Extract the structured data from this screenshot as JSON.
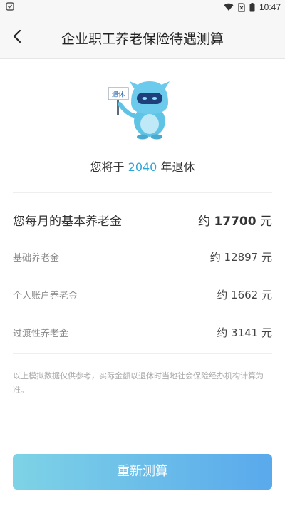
{
  "status_bar": {
    "time": "10:47"
  },
  "header": {
    "title": "企业职工养老保险待遇测算"
  },
  "mascot": {
    "sign_text": "退休"
  },
  "retire": {
    "prefix": "您将于",
    "year": "2040",
    "suffix": "年退休"
  },
  "pension": {
    "main": {
      "label": "您每月的基本养老金",
      "prefix": "约",
      "amount": "17700",
      "unit": "元"
    },
    "items": [
      {
        "label": "基础养老金",
        "value": "约 12897 元"
      },
      {
        "label": "个人账户养老金",
        "value": "约 1662 元"
      },
      {
        "label": "过渡性养老金",
        "value": "约 3141 元"
      }
    ]
  },
  "disclaimer": "以上模拟数据仅供参考，实际金额以退休时当地社会保险经办机构计算为准。",
  "actions": {
    "recalculate_label": "重新测算"
  },
  "colors": {
    "accent": "#2ea6d8",
    "button_start": "#7ed3e6",
    "button_end": "#59a9ec"
  },
  "icons": [
    "app-notification-icon",
    "wifi-icon",
    "sim-icon",
    "battery-icon",
    "back-arrow-icon",
    "mascot-icon"
  ]
}
